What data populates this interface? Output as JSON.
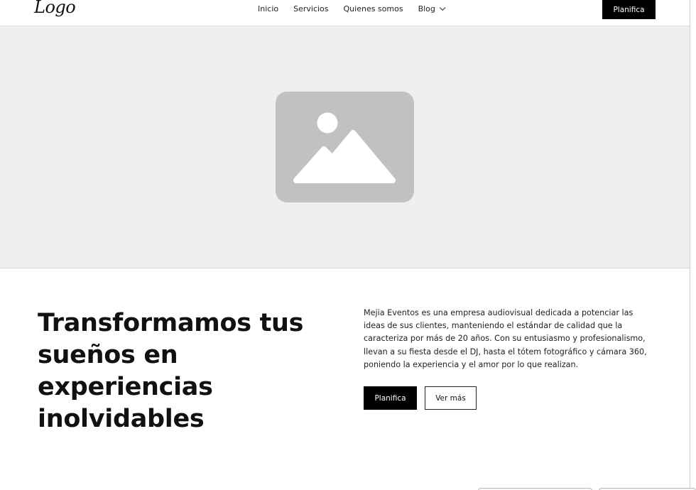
{
  "header": {
    "logo": "Logo",
    "nav": [
      {
        "label": "Inicio"
      },
      {
        "label": "Servicios"
      },
      {
        "label": "Quienes somos"
      },
      {
        "label": "Blog",
        "has_dropdown": true
      }
    ],
    "cta_label": "Planifica"
  },
  "hero": {
    "image_icon": "image-placeholder-icon",
    "placeholder_color": "#c1c1c1",
    "background_color": "#efefef"
  },
  "content": {
    "headline": "Transformamos tus sueños en experiencias inolvidables",
    "description": "Mejia Eventos es una empresa audiovisual dedicada a potenciar las ideas de sus clientes, manteniendo el estándar de calidad que la caracteriza por más de 20 años. Con su entusiasmo y profesionalismo, llevan a su fiesta desde el DJ, hasta el tótem fotográfico y cámara 360, poniendo la experiencia y el amor por lo que realizan.",
    "primary_button": "Planifica",
    "secondary_button": "Ver más"
  },
  "colors": {
    "accent": "#000000",
    "text": "#111111",
    "pink": "#e53975",
    "red": "#e52a2a"
  }
}
